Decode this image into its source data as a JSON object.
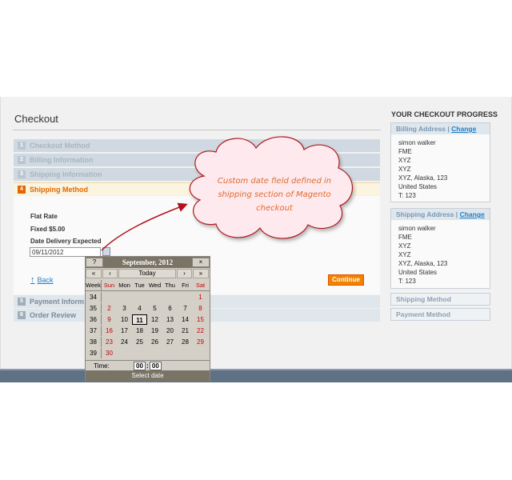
{
  "page": {
    "title": "Checkout"
  },
  "steps": [
    {
      "num": "1",
      "label": "Checkout Method"
    },
    {
      "num": "2",
      "label": "Billing Information"
    },
    {
      "num": "3",
      "label": "Shipping Information"
    },
    {
      "num": "4",
      "label": "Shipping Method"
    },
    {
      "num": "5",
      "label": "Payment Inform"
    },
    {
      "num": "6",
      "label": "Order Review"
    }
  ],
  "shipping_method": {
    "rate_name": "Flat Rate",
    "rate_price": "Fixed $5.00",
    "date_label": "Date Delivery Expected",
    "date_value": "09/11/2012",
    "back_label": "Back",
    "back_icon": "up-arrow-icon",
    "continue_label": "Continue"
  },
  "calendar": {
    "help": "?",
    "title": "September, 2012",
    "close": "×",
    "prev_year": "«",
    "prev_month": "‹",
    "today": "Today",
    "next_month": "›",
    "next_year": "»",
    "week_label": "Week",
    "weekdays": [
      "Sun",
      "Mon",
      "Tue",
      "Wed",
      "Thu",
      "Fri",
      "Sat"
    ],
    "weeks": [
      {
        "wk": "34",
        "days": [
          "",
          "",
          "",
          "",
          "",
          "",
          "1"
        ]
      },
      {
        "wk": "35",
        "days": [
          "2",
          "3",
          "4",
          "5",
          "6",
          "7",
          "8"
        ]
      },
      {
        "wk": "36",
        "days": [
          "9",
          "10",
          "11",
          "12",
          "13",
          "14",
          "15"
        ]
      },
      {
        "wk": "37",
        "days": [
          "16",
          "17",
          "18",
          "19",
          "20",
          "21",
          "22"
        ]
      },
      {
        "wk": "38",
        "days": [
          "23",
          "24",
          "25",
          "26",
          "27",
          "28",
          "29"
        ]
      },
      {
        "wk": "39",
        "days": [
          "30",
          "",
          "",
          "",
          "",
          "",
          ""
        ]
      }
    ],
    "selected_day": "11",
    "time_label": "Time:",
    "hour": "00",
    "minute": "00",
    "footer": "Select date",
    "weekend_color": "#cc0000"
  },
  "progress": {
    "title": "YOUR CHECKOUT PROGRESS",
    "billing": {
      "heading": "Billing Address",
      "sep": "|",
      "change": "Change",
      "lines": [
        "simon walker",
        "FME",
        "XYZ",
        "XYZ",
        "XYZ, Alaska, 123",
        "United States",
        "T: 123"
      ]
    },
    "shipping": {
      "heading": "Shipping Address",
      "sep": "|",
      "change": "Change",
      "lines": [
        "simon walker",
        "FME",
        "XYZ",
        "XYZ",
        "XYZ, Alaska, 123",
        "United States",
        "T: 123"
      ]
    },
    "shipping_method": "Shipping Method",
    "payment_method": "Payment Method"
  },
  "annotation": {
    "lines": [
      "Custom date field defined in",
      "shipping section of Magento",
      "checkout"
    ],
    "color": "#e06a2a"
  },
  "colors": {
    "accent_orange": "#f18200",
    "link_blue": "#1e7ec8",
    "arrow_red": "#b0131c"
  }
}
